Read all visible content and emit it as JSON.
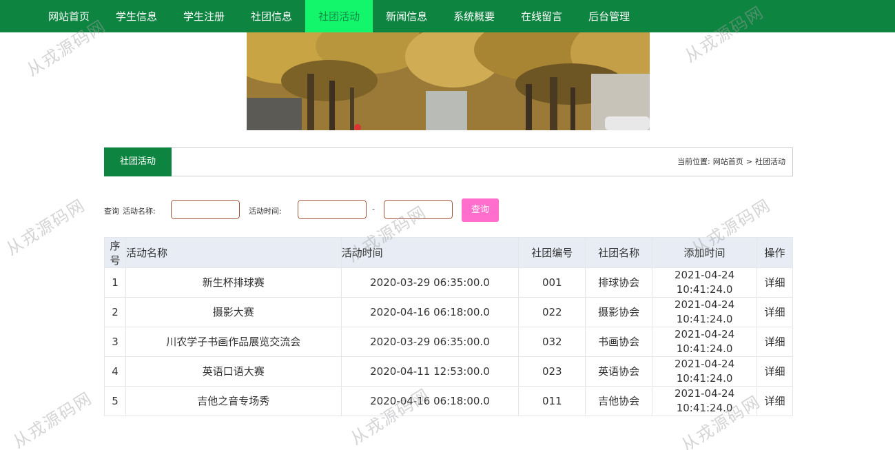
{
  "nav": {
    "items": [
      {
        "label": "网站首页"
      },
      {
        "label": "学生信息"
      },
      {
        "label": "学生注册"
      },
      {
        "label": "社团信息"
      },
      {
        "label": "社团活动",
        "active": true
      },
      {
        "label": "新闻信息"
      },
      {
        "label": "系统概要"
      },
      {
        "label": "在线留言"
      },
      {
        "label": "后台管理"
      }
    ]
  },
  "section": {
    "title": "社团活动",
    "breadcrumb": {
      "prefix": "当前位置:",
      "home": "网站首页",
      "sep": ">",
      "current": "社团活动"
    }
  },
  "search": {
    "label": "查询",
    "name_label": "活动名称:",
    "name_value": "",
    "time_label": "活动时间:",
    "time_from": "",
    "dash": "-",
    "time_to": "",
    "button": "查询"
  },
  "table": {
    "headers": {
      "idx": "序号",
      "name": "活动名称",
      "time": "活动时间",
      "no": "社团编号",
      "club": "社团名称",
      "added": "添加时间",
      "op": "操作"
    },
    "rows": [
      {
        "idx": "1",
        "name": "新生杯排球赛",
        "time": "2020-03-29 06:35:00.0",
        "no": "001",
        "club": "排球协会",
        "added_date": "2021-04-24",
        "added_time": "10:41:24.0",
        "op": "详细"
      },
      {
        "idx": "2",
        "name": "摄影大赛",
        "time": "2020-04-16 06:18:00.0",
        "no": "022",
        "club": "摄影协会",
        "added_date": "2021-04-24",
        "added_time": "10:41:24.0",
        "op": "详细"
      },
      {
        "idx": "3",
        "name": "川农学子书画作品展览交流会",
        "time": "2020-03-29 06:35:00.0",
        "no": "032",
        "club": "书画协会",
        "added_date": "2021-04-24",
        "added_time": "10:41:24.0",
        "op": "详细"
      },
      {
        "idx": "4",
        "name": "英语口语大赛",
        "time": "2020-04-11 12:53:00.0",
        "no": "023",
        "club": "英语协会",
        "added_date": "2021-04-24",
        "added_time": "10:41:24.0",
        "op": "详细"
      },
      {
        "idx": "5",
        "name": "吉他之音专场秀",
        "time": "2020-04-16 06:18:00.0",
        "no": "011",
        "club": "吉他协会",
        "added_date": "2021-04-24",
        "added_time": "10:41:24.0",
        "op": "详细"
      }
    ]
  },
  "watermark": "从戎源码网",
  "colors": {
    "nav_bg": "#0e8441",
    "nav_active": "#13f56b",
    "button": "#ff6ecc",
    "table_head": "#e8edf5"
  }
}
